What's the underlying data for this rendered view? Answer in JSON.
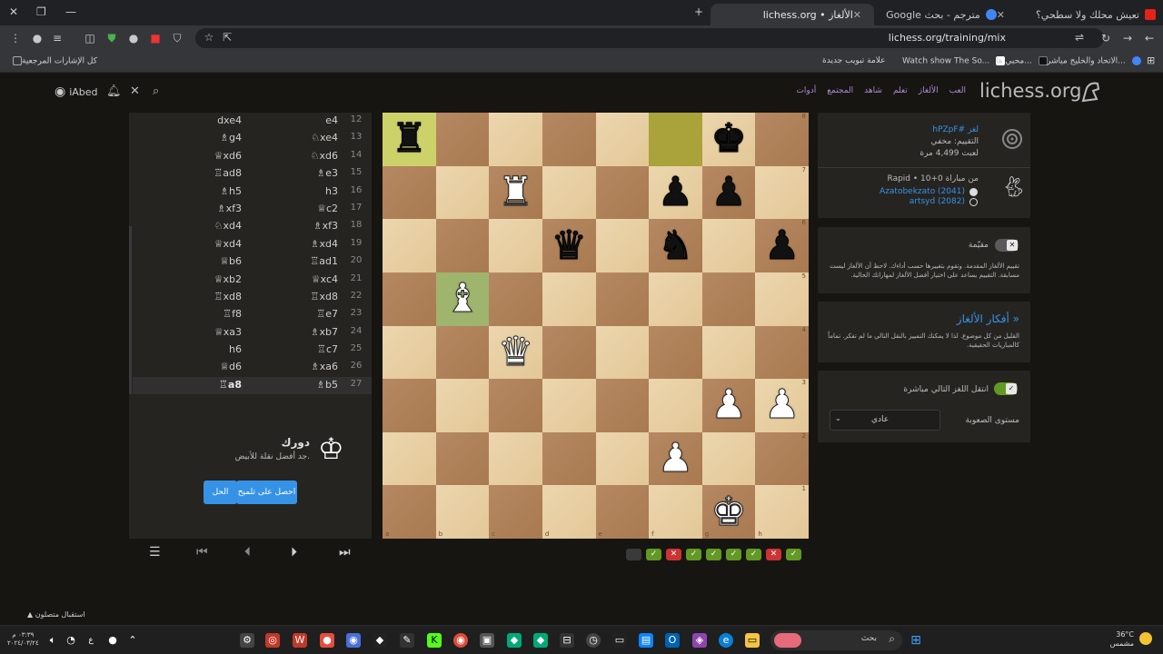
{
  "browser": {
    "tabs": [
      {
        "title": "تعيش محلك ولا سطحي؟",
        "active": false
      },
      {
        "title": "مترجم - بحث Google",
        "active": false
      },
      {
        "title": "الألغاز • lichess.org",
        "active": true
      }
    ],
    "url": "lichess.org/training/mix",
    "bookmarks": {
      "all": "كل الإشارات المرجعية",
      "items": [
        "الاتحاد والخليج مباشر...",
        "محبي ها...",
        "Watch show The So...",
        "علامة تبويب جديدة"
      ]
    }
  },
  "header": {
    "logo": "lichess.org",
    "nav": [
      "العب",
      "الألغاز",
      "تعلم",
      "شاهد",
      "المجتمع",
      "أدوات"
    ],
    "username": "iAbed"
  },
  "moves": [
    {
      "num": "12",
      "white": "e4",
      "black": "dxe4"
    },
    {
      "num": "13",
      "white": "♘xe4",
      "black": "♗g4"
    },
    {
      "num": "14",
      "white": "♘xd6",
      "black": "♕xd6"
    },
    {
      "num": "15",
      "white": "♗e3",
      "black": "♖ad8"
    },
    {
      "num": "16",
      "white": "h3",
      "black": "♗h5"
    },
    {
      "num": "17",
      "white": "♕c2",
      "black": "♗xf3"
    },
    {
      "num": "18",
      "white": "♗xf3",
      "black": "♘xd4"
    },
    {
      "num": "19",
      "white": "♗xd4",
      "black": "♕xd4"
    },
    {
      "num": "20",
      "white": "♖ad1",
      "black": "♕b6"
    },
    {
      "num": "21",
      "white": "♕xc4",
      "black": "♕xb2"
    },
    {
      "num": "22",
      "white": "♖xd8",
      "black": "♖xd8"
    },
    {
      "num": "23",
      "white": "♖e7",
      "black": "♖f8"
    },
    {
      "num": "24",
      "white": "♗xb7",
      "black": "♕xa3"
    },
    {
      "num": "25",
      "white": "♖c7",
      "black": "h6"
    },
    {
      "num": "26",
      "white": "♗xa6",
      "black": "♕d6"
    },
    {
      "num": "27",
      "white": "♗b5",
      "black": "♖a8"
    }
  ],
  "task": {
    "title": "دورك",
    "desc": "جد أفضل نقلة للأبيض.",
    "btn_hint": "احصل على تلميح",
    "btn_solution": "الحل"
  },
  "controls": [
    "first",
    "prev",
    "next",
    "last",
    "menu"
  ],
  "board": {
    "ranks": [
      [
        "br",
        "",
        "",
        "",
        "",
        "",
        "bk",
        ""
      ],
      [
        "",
        "",
        "wr",
        "",
        "",
        "bp",
        "bp",
        ""
      ],
      [
        "",
        "",
        "",
        "bq",
        "",
        "bn",
        "",
        "bp"
      ],
      [
        "",
        "wb",
        "",
        "",
        "",
        "",
        "",
        ""
      ],
      [
        "",
        "",
        "wq",
        "",
        "",
        "",
        "",
        ""
      ],
      [
        "",
        "",
        "",
        "",
        "",
        "",
        "wp",
        "wp"
      ],
      [
        "",
        "",
        "",
        "",
        "",
        "wp",
        "",
        ""
      ],
      [
        "",
        "",
        "",
        "",
        "",
        "",
        "wk",
        ""
      ]
    ],
    "files": [
      "a",
      "b",
      "c",
      "d",
      "e",
      "f",
      "g",
      "h"
    ],
    "rank_labels": [
      "8",
      "7",
      "6",
      "5",
      "4",
      "3",
      "2",
      "1"
    ],
    "highlights": {
      "a8": "last",
      "f8": "last",
      "b5": "check"
    }
  },
  "results": [
    "pending",
    "ok",
    "fail",
    "ok",
    "ok",
    "ok",
    "ok",
    "fail",
    "ok"
  ],
  "puzzle_info": {
    "id": "لغز #hPZpF",
    "rating": "التقييم: مخفي",
    "plays": "لعبت 4,499 مرة",
    "from": "من مباراة Rapid • 10+0",
    "player_white": "Azatobekzato (2041)",
    "player_black": "artsyd (2082)"
  },
  "jump_panel": {
    "label": "مقيّمة",
    "text": "تقييم الألغاز المقدمة. وتقوم بتغييرها حسب أداءك. لاحظ أن الألغاز ليست مسابقة. التقييم يساعد على اختيار أفضل الألغاز لمهاراتك الحالية."
  },
  "themes": {
    "title": "« أفكار الألغاز",
    "text": "القليل من كل موضوع. لذا لا يمكنك التمييز بالنقل التالي ما لم تفكر. تماماً كالمباريات الحقيقية."
  },
  "settings": {
    "jump_label": "انتقل اللغز التالي مباشرة",
    "difficulty_label": "مستوى الصعوبة",
    "difficulty_value": "عادي"
  },
  "taskbar": {
    "time": "٠٣:٣٩ م",
    "date": "٢٠٢٤/٠٣/٢٤",
    "weather_temp": "36°C",
    "weather_desc": "مشمس",
    "search": "بحث",
    "notif": "استقبال متصلون",
    "lang": "ع"
  }
}
